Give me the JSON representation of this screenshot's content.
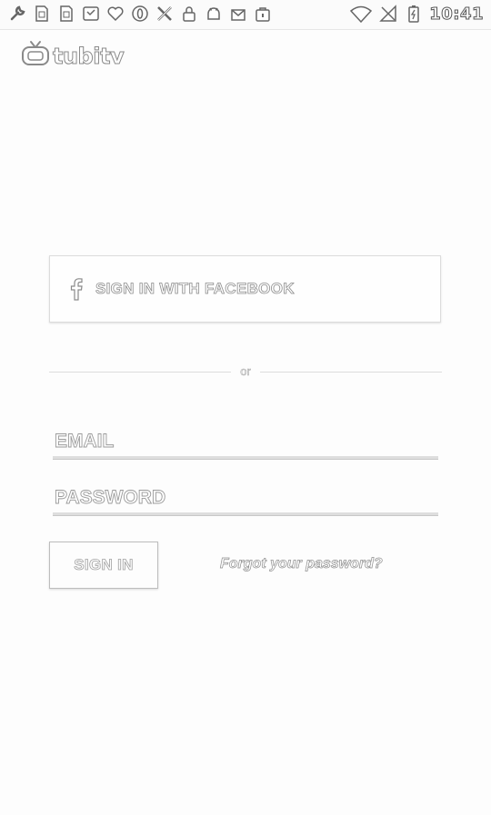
{
  "status_bar": {
    "time": "10:41",
    "left_icons": [
      "wrench-icon",
      "sim-icon",
      "sim-icon",
      "voicemail-icon",
      "heart-icon",
      "opera-icon",
      "tools-icon",
      "lock-icon",
      "android-icon",
      "mail-icon",
      "bag-icon"
    ],
    "right_icons": [
      "wifi-icon",
      "no-signal-icon",
      "battery-icon"
    ]
  },
  "logo": {
    "text": "tubitv"
  },
  "facebook_button": {
    "label": "SIGN IN WITH FACEBOOK"
  },
  "divider": {
    "label": "or"
  },
  "email_field": {
    "placeholder": "EMAIL",
    "value": ""
  },
  "password_field": {
    "placeholder": "PASSWORD",
    "value": ""
  },
  "signin_button": {
    "label": "SIGN IN"
  },
  "forgot_link": {
    "label": "Forgot your password?"
  },
  "colors": {
    "background": "#fdfdfd",
    "outline": "#8c8c8c",
    "divider": "#dcdcdc"
  }
}
